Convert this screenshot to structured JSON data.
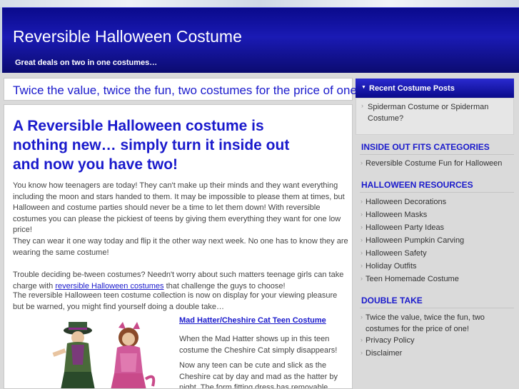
{
  "header": {
    "title": "Reversible Halloween Costume",
    "description": "Great deals on two in one costumes…"
  },
  "tagline": "Twice the value, twice the fun, two costumes for the price of one!",
  "post": {
    "title": "A Reversible Halloween costume is nothing new… simply turn it inside out and now you have two!",
    "p1": "You know how teenagers are today! They can't make up their minds and they want everything including the moon and stars handed to them. It may be impossible to please them at times, but Halloween and costume parties should never be a time to let them down! With reversible costumes you can please the pickiest of teens by giving them everything they want for one low price!",
    "p2": "They can wear it one way today and flip it the other way next week. No one has to know they are wearing the same costume!",
    "p3_before": "Trouble deciding be-tween costumes? Needn't worry about such matters  teenage girls can take charge with ",
    "p3_link": "reversible Halloween costumes",
    "p3_after": " that challenge the guys to choose!",
    "p4": "The reversible Halloween teen costume collection is now on display for your viewing pleasure but be warned, you might find yourself doing a double take…",
    "product_link": "Mad Hatter/Cheshire Cat Teen Costume",
    "product_p1": "When the Mad Hatter shows up in this teen costume the Cheshire Cat simply disappears!",
    "product_p2": "Now any teen can be cute and slick as the Cheshire cat by day and mad as the hatter by night. The form fitting dress has removable"
  },
  "sidebar": {
    "recent": {
      "heading": "Recent Costume Posts",
      "items": [
        "Spiderman Costume or Spiderman Costume?"
      ]
    },
    "categories": {
      "heading": "INSIDE OUT FITS CATEGORIES",
      "items": [
        "Reversible Costume Fun for Halloween"
      ]
    },
    "resources": {
      "heading": "HALLOWEEN RESOURCES",
      "items": [
        "Halloween Decorations",
        "Halloween Masks",
        "Halloween Party Ideas",
        "Halloween Pumpkin Carving",
        "Halloween Safety",
        "Holiday Outfits",
        "Teen Homemade Costume"
      ]
    },
    "double_take": {
      "heading": "DOUBLE TAKE",
      "items": [
        "Twice the value, twice the fun, two costumes for the price of one!",
        "Privacy Policy",
        "Disclaimer"
      ]
    }
  },
  "colors": {
    "header_blue": "#1a1ab4",
    "link_blue": "#1a1acc",
    "sidebar_bg": "#dadada"
  }
}
